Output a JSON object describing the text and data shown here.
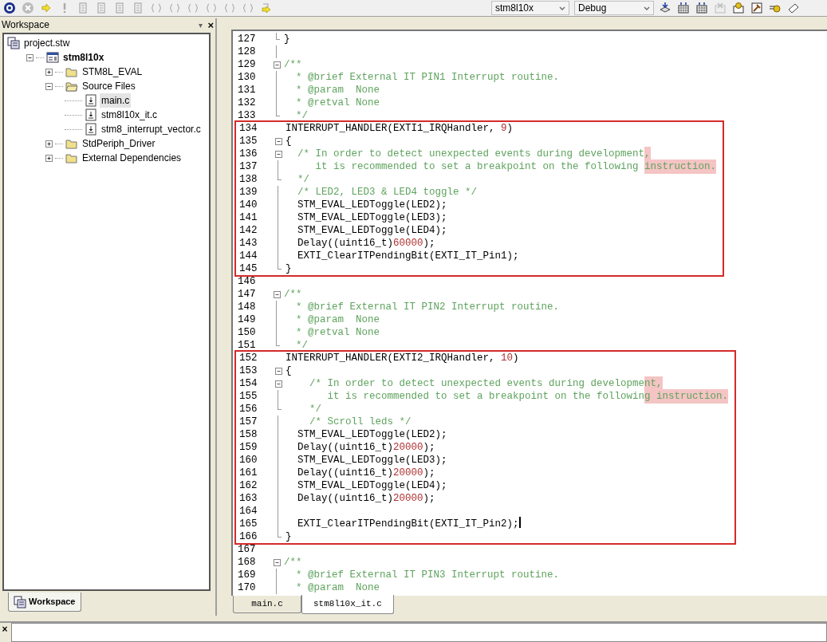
{
  "toolbar": {
    "target": "stm8l10x",
    "configuration": "Debug"
  },
  "workspace": {
    "title": "Workspace",
    "minimize_glyph": "▾",
    "close_glyph": "×",
    "tree": [
      {
        "kind": "workspace",
        "label": "project.stw",
        "selected": false,
        "children": [
          {
            "kind": "project",
            "label": "stm8l10x",
            "selected": false,
            "expanded": true,
            "children": [
              {
                "kind": "folder",
                "label": "STM8L_EVAL",
                "selected": false,
                "expanded": false
              },
              {
                "kind": "folder",
                "label": "Source Files",
                "selected": false,
                "expanded": true,
                "children": [
                  {
                    "kind": "file",
                    "label": "main.c",
                    "selected": true
                  },
                  {
                    "kind": "file",
                    "label": "stm8l10x_it.c",
                    "selected": false
                  },
                  {
                    "kind": "file",
                    "label": "stm8_interrupt_vector.c",
                    "selected": false
                  }
                ]
              },
              {
                "kind": "folder",
                "label": "StdPeriph_Driver",
                "selected": false,
                "expanded": false
              },
              {
                "kind": "folder",
                "label": "External Dependencies",
                "selected": false,
                "expanded": false
              }
            ]
          }
        ]
      }
    ],
    "bottom_tab": {
      "label": "Workspace",
      "selected": true
    }
  },
  "editor": {
    "blocks": [
      {
        "boxed": false,
        "lines": [
          {
            "number": "127",
            "kind": "end",
            "segments": [
              {
                "kind": "code",
                "text": "}"
              }
            ]
          },
          {
            "number": "128",
            "kind": "body"
          },
          {
            "number": "129",
            "kind": "open",
            "segments": [
              {
                "kind": "comment",
                "text": "/**"
              }
            ]
          },
          {
            "number": "130",
            "kind": "body",
            "segments": [
              {
                "kind": "comment",
                "text": "  * @brief External IT PIN1 Interrupt routine."
              }
            ]
          },
          {
            "number": "131",
            "kind": "body",
            "segments": [
              {
                "kind": "comment",
                "text": "  * @param  None"
              }
            ]
          },
          {
            "number": "132",
            "kind": "body",
            "segments": [
              {
                "kind": "comment",
                "text": "  * @retval None"
              }
            ]
          },
          {
            "number": "133",
            "kind": "end",
            "segments": [
              {
                "kind": "comment",
                "text": "  */"
              }
            ]
          }
        ]
      },
      {
        "boxed": true,
        "lines": [
          {
            "number": "134",
            "kind": "plain",
            "segments": [
              {
                "kind": "code",
                "text": "INTERRUPT_HANDLER(EXTI1_IRQHandler, "
              },
              {
                "kind": "number",
                "text": "9"
              },
              {
                "kind": "code",
                "text": ")"
              }
            ]
          },
          {
            "number": "135",
            "kind": "open",
            "segments": [
              {
                "kind": "code",
                "text": "{"
              }
            ]
          },
          {
            "number": "136",
            "kind": "open",
            "segments": [
              {
                "kind": "comment",
                "text": "  /* In order to detect unexpected events during development"
              },
              {
                "kind": "comment",
                "text": ",",
                "highlight": true
              }
            ]
          },
          {
            "number": "137",
            "kind": "body",
            "segments": [
              {
                "kind": "comment",
                "text": "     it is recommended to set a breakpoint on the following "
              },
              {
                "kind": "comment",
                "text": "instruction.",
                "highlight": true
              }
            ]
          },
          {
            "number": "138",
            "kind": "end",
            "segments": [
              {
                "kind": "comment",
                "text": "  */"
              }
            ]
          },
          {
            "number": "139",
            "kind": "body",
            "segments": [
              {
                "kind": "comment",
                "text": "  /* LED2, LED3 & LED4 toggle */"
              }
            ]
          },
          {
            "number": "140",
            "kind": "body",
            "segments": [
              {
                "kind": "code",
                "text": "  STM_EVAL_LEDToggle(LED2);"
              }
            ]
          },
          {
            "number": "141",
            "kind": "body",
            "segments": [
              {
                "kind": "code",
                "text": "  STM_EVAL_LEDToggle(LED3);"
              }
            ]
          },
          {
            "number": "142",
            "kind": "body",
            "segments": [
              {
                "kind": "code",
                "text": "  STM_EVAL_LEDToggle(LED4);"
              }
            ]
          },
          {
            "number": "143",
            "kind": "body",
            "segments": [
              {
                "kind": "code",
                "text": "  Delay((uint16_t)"
              },
              {
                "kind": "number",
                "text": "60000"
              },
              {
                "kind": "code",
                "text": ");"
              }
            ]
          },
          {
            "number": "144",
            "kind": "body",
            "segments": [
              {
                "kind": "code",
                "text": "  EXTI_ClearITPendingBit(EXTI_IT_Pin1);"
              }
            ]
          },
          {
            "number": "145",
            "kind": "end",
            "segments": [
              {
                "kind": "code",
                "text": "}"
              }
            ]
          }
        ]
      },
      {
        "boxed": false,
        "lines": [
          {
            "number": "146",
            "kind": "plain"
          },
          {
            "number": "147",
            "kind": "open",
            "segments": [
              {
                "kind": "comment",
                "text": "/**"
              }
            ]
          },
          {
            "number": "148",
            "kind": "body",
            "segments": [
              {
                "kind": "comment",
                "text": "  * @brief External IT PIN2 Interrupt routine."
              }
            ]
          },
          {
            "number": "149",
            "kind": "body",
            "segments": [
              {
                "kind": "comment",
                "text": "  * @param  None"
              }
            ]
          },
          {
            "number": "150",
            "kind": "body",
            "segments": [
              {
                "kind": "comment",
                "text": "  * @retval None"
              }
            ]
          },
          {
            "number": "151",
            "kind": "end",
            "segments": [
              {
                "kind": "comment",
                "text": "  */"
              }
            ]
          }
        ]
      },
      {
        "boxed": true,
        "lines": [
          {
            "number": "152",
            "kind": "plain",
            "segments": [
              {
                "kind": "code",
                "text": "INTERRUPT_HANDLER(EXTI2_IRQHandler, "
              },
              {
                "kind": "number",
                "text": "10"
              },
              {
                "kind": "code",
                "text": ")"
              }
            ]
          },
          {
            "number": "153",
            "kind": "open",
            "segments": [
              {
                "kind": "code",
                "text": "{"
              }
            ]
          },
          {
            "number": "154",
            "kind": "open",
            "segments": [
              {
                "kind": "comment",
                "text": "    /* In order to detect unexpected events during developme"
              },
              {
                "kind": "comment",
                "text": "nt,",
                "highlight": true
              }
            ]
          },
          {
            "number": "155",
            "kind": "body",
            "segments": [
              {
                "kind": "comment",
                "text": "       it is recommended to set a breakpoint on the followin"
              },
              {
                "kind": "comment",
                "text": "g instruction.",
                "highlight": true
              }
            ]
          },
          {
            "number": "156",
            "kind": "end",
            "segments": [
              {
                "kind": "comment",
                "text": "    */"
              }
            ]
          },
          {
            "number": "157",
            "kind": "body",
            "segments": [
              {
                "kind": "comment",
                "text": "    /* Scroll leds */"
              }
            ]
          },
          {
            "number": "158",
            "kind": "body",
            "segments": [
              {
                "kind": "code",
                "text": "  STM_EVAL_LEDToggle(LED2);"
              }
            ]
          },
          {
            "number": "159",
            "kind": "body",
            "segments": [
              {
                "kind": "code",
                "text": "  Delay((uint16_t)"
              },
              {
                "kind": "number",
                "text": "20000"
              },
              {
                "kind": "code",
                "text": ");"
              }
            ]
          },
          {
            "number": "160",
            "kind": "body",
            "segments": [
              {
                "kind": "code",
                "text": "  STM_EVAL_LEDToggle(LED3);"
              }
            ]
          },
          {
            "number": "161",
            "kind": "body",
            "segments": [
              {
                "kind": "code",
                "text": "  Delay((uint16_t)"
              },
              {
                "kind": "number",
                "text": "20000"
              },
              {
                "kind": "code",
                "text": ");"
              }
            ]
          },
          {
            "number": "162",
            "kind": "body",
            "segments": [
              {
                "kind": "code",
                "text": "  STM_EVAL_LEDToggle(LED4);"
              }
            ]
          },
          {
            "number": "163",
            "kind": "body",
            "segments": [
              {
                "kind": "code",
                "text": "  Delay((uint16_t)"
              },
              {
                "kind": "number",
                "text": "20000"
              },
              {
                "kind": "code",
                "text": ");"
              }
            ]
          },
          {
            "number": "164",
            "kind": "body"
          },
          {
            "number": "165",
            "kind": "body",
            "cursor": true,
            "segments": [
              {
                "kind": "code",
                "text": "  EXTI_ClearITPendingBit(EXTI_IT_Pin2);"
              }
            ]
          },
          {
            "number": "166",
            "kind": "end",
            "segments": [
              {
                "kind": "code",
                "text": "}"
              }
            ]
          }
        ]
      },
      {
        "boxed": false,
        "lines": [
          {
            "number": "167",
            "kind": "plain"
          },
          {
            "number": "168",
            "kind": "open",
            "segments": [
              {
                "kind": "comment",
                "text": "/**"
              }
            ]
          },
          {
            "number": "169",
            "kind": "body",
            "segments": [
              {
                "kind": "comment",
                "text": "  * @brief External IT PIN3 Interrupt routine."
              }
            ]
          },
          {
            "number": "170",
            "kind": "body",
            "segments": [
              {
                "kind": "comment",
                "text": "  * @param  None"
              }
            ]
          }
        ]
      }
    ],
    "tabs": [
      {
        "label": "main.c",
        "selected": false
      },
      {
        "label": "stm8l10x_it.c",
        "selected": true
      }
    ]
  },
  "output_panel": {
    "close_glyph": "×"
  }
}
